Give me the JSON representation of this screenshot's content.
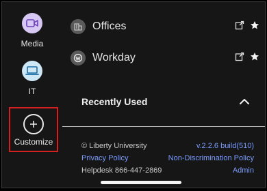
{
  "rail": {
    "items": [
      {
        "label": "Media",
        "icon": "video-icon",
        "color": "#d7c8f3"
      },
      {
        "label": "IT",
        "icon": "laptop-icon",
        "color": "#cde7f6"
      },
      {
        "label": "Customize",
        "icon": "plus-circle-icon",
        "highlight": "#d42020"
      }
    ]
  },
  "links": [
    {
      "label": "Offices",
      "icon": "building-icon"
    },
    {
      "label": "Workday",
      "icon": "workday-icon"
    }
  ],
  "recently_used": {
    "label": "Recently Used",
    "state": "expanded"
  },
  "footer": {
    "copyright": "© Liberty University",
    "version": "v.2.2.6 build(510)",
    "privacy": "Privacy Policy",
    "nondiscrimination": "Non-Discrimination Policy",
    "helpdesk": "Helpdesk 866-447-2869",
    "admin": "Admin"
  },
  "colors": {
    "background": "#161616",
    "link": "#7b9dff",
    "highlight": "#d42020"
  }
}
